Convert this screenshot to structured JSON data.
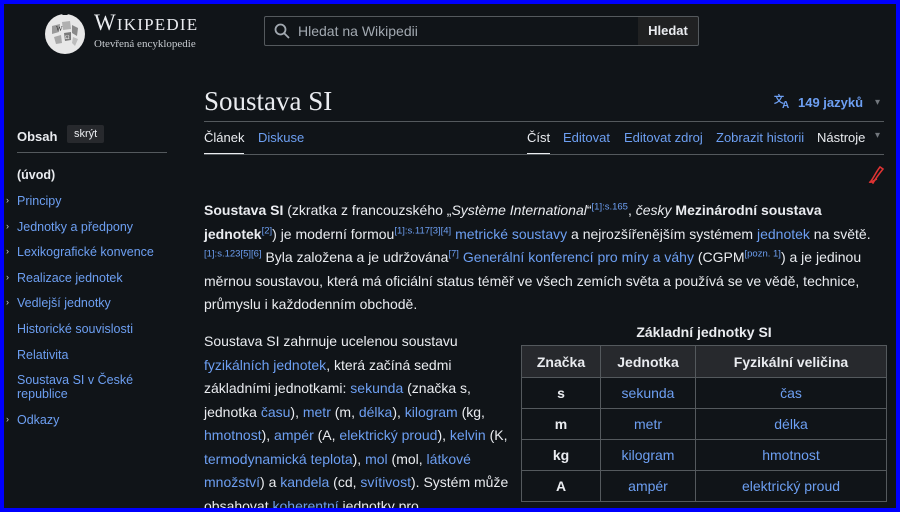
{
  "header": {
    "wordmark": "Wikipedie",
    "tagline": "Otevřená encyklopedie",
    "search_placeholder": "Hledat na Wikipedii",
    "search_button": "Hledat"
  },
  "article": {
    "title": "Soustava SI",
    "languages": "149 jazyků"
  },
  "tabs": {
    "left": [
      "Článek",
      "Diskuse"
    ],
    "right": [
      "Číst",
      "Editovat",
      "Editovat zdroj",
      "Zobrazit historii",
      "Nástroje"
    ]
  },
  "toc": {
    "heading": "Obsah",
    "hide": "skrýt",
    "items": [
      "(úvod)",
      "Principy",
      "Jednotky a předpony",
      "Lexikografické konvence",
      "Realizace jednotek",
      "Vedlejší jednotky",
      "Historické souvislosti",
      "Relativita",
      "Soustava SI v České republice",
      "Odkazy"
    ]
  },
  "intro": {
    "t1": "Soustava SI",
    "t2": " (zkratka z francouzského „",
    "t3": "Système International",
    "t4": "“",
    "r1": "[1]:s.165",
    "t5": ", ",
    "t6": "česky",
    "t7": " Mezinárodní soustava jednotek",
    "r2": "[2]",
    "t8": ") je moderní formou",
    "r3": "[1]:s.117[3][4]",
    "l1": "metrické soustavy",
    "t9": " a nejrozšířenějším systémem ",
    "l2": "jednotek",
    "t10": " na světě.",
    "r4": "[1]:s.123[5][6]",
    "t11": " Byla založena a je udržována",
    "r5": "[7]",
    "l3": "Generální konferencí pro míry a váhy",
    "t12": " (CGPM",
    "r6": "[pozn. 1]",
    "t13": ") a je jedinou měrnou soustavou, která má oficiální status téměř ve všech zemích světa a používá se ve vědě, technice, průmyslu i každodenním obchodě."
  },
  "second": {
    "a": "Soustava SI zahrnuje ucelenou soustavu ",
    "b": "fyzikálních jednotek",
    "c": ", která začíná sedmi základními jednotkami: ",
    "d": "sekunda",
    "e": " (značka s, jednotka ",
    "f": "času",
    "g": "), ",
    "h": "metr",
    "i": " (m, ",
    "j": "délka",
    "k": "), ",
    "l": "kilogram",
    "m": " (kg, ",
    "n": "hmotnost",
    "o": "), ",
    "p": "ampér",
    "q": " (A, ",
    "r": "elektrický proud",
    "s": "), ",
    "t": "kelvin",
    "u": " (K, ",
    "v": "termodynamická teplota",
    "w": "), ",
    "x": "mol",
    "y": " (mol, ",
    "z": "látkové množství",
    "aa": ") a ",
    "bb": "kandela",
    "cc": " (cd, ",
    "dd": "svítivost",
    "ee": "). Systém může obsahovat ",
    "ff": "koherentní",
    "gg": " jednotky pro"
  },
  "table": {
    "caption": "Základní jednotky SI",
    "headers": [
      "Značka",
      "Jednotka",
      "Fyzikální veličina"
    ],
    "rows": [
      [
        "s",
        "sekunda",
        "čas"
      ],
      [
        "m",
        "metr",
        "délka"
      ],
      [
        "kg",
        "kilogram",
        "hmotnost"
      ],
      [
        "A",
        "ampér",
        "elektrický proud"
      ]
    ]
  },
  "colors": {
    "background": "#101418",
    "link": "#6d9ff2",
    "text": "#eaecf0",
    "border_frame": "#0000ff"
  },
  "icons": [
    "wikipedia-globe-icon",
    "search-icon",
    "translate-icon",
    "chevron-down-icon",
    "pen-icon"
  ]
}
